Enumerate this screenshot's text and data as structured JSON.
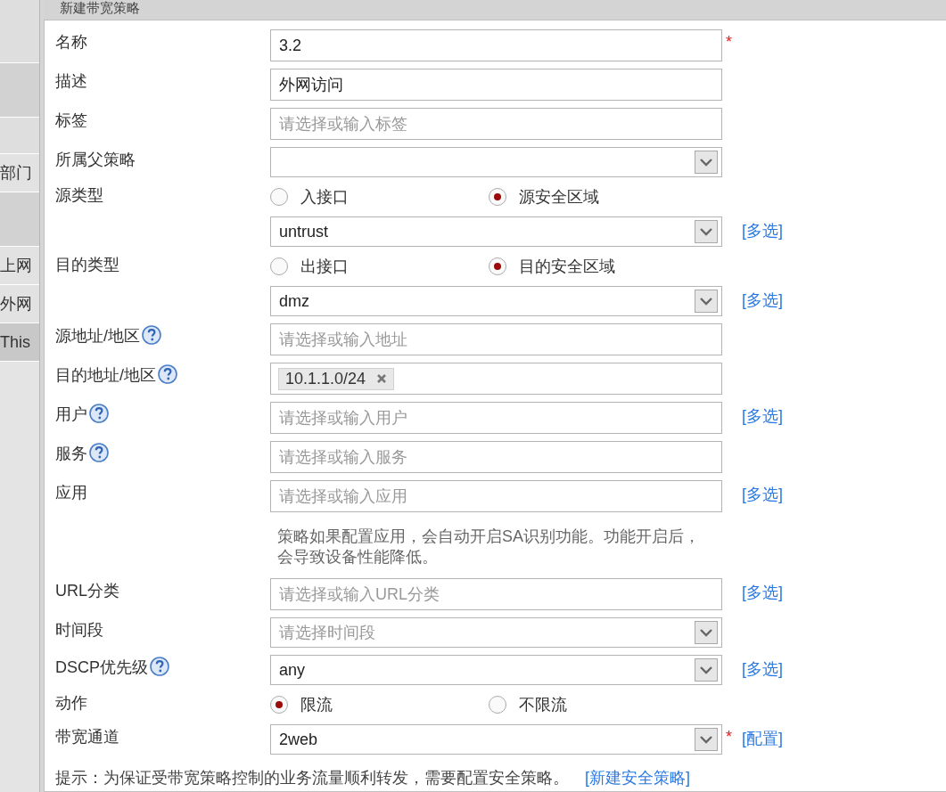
{
  "sidebar": {
    "items": [
      {
        "label": "部门",
        "selected": false
      },
      {
        "label": "上网",
        "selected": false
      },
      {
        "label": "外网",
        "selected": false
      },
      {
        "label": "This",
        "selected": true
      }
    ]
  },
  "dialog": {
    "title": "新建带宽策略"
  },
  "rows": [
    {
      "kind": "text",
      "label": "名称",
      "value": "3.2",
      "required_mark": "*"
    },
    {
      "kind": "text",
      "label": "描述",
      "value": "外网访问"
    },
    {
      "kind": "text",
      "label": "标签",
      "placeholder": "请选择或输入标签"
    },
    {
      "kind": "select",
      "label": "所属父策略"
    },
    {
      "kind": "radio",
      "label": "源类型",
      "options": [
        {
          "label": "入接口",
          "selected": false
        },
        {
          "label": "源安全区域",
          "selected": true
        }
      ]
    },
    {
      "kind": "select",
      "value": "untrust",
      "link": "[多选]"
    },
    {
      "kind": "radio",
      "label": "目的类型",
      "options": [
        {
          "label": "出接口",
          "selected": false
        },
        {
          "label": "目的安全区域",
          "selected": true
        }
      ]
    },
    {
      "kind": "select",
      "value": "dmz",
      "link": "[多选]"
    },
    {
      "kind": "text",
      "label": "源地址/地区",
      "help": true,
      "placeholder": "请选择或输入地址"
    },
    {
      "kind": "tags",
      "label": "目的地址/地区",
      "help": true,
      "tags": [
        "10.1.1.0/24"
      ]
    },
    {
      "kind": "text",
      "label": "用户",
      "help": true,
      "placeholder": "请选择或输入用户",
      "link": "[多选]"
    },
    {
      "kind": "text",
      "label": "服务",
      "help": true,
      "placeholder": "请选择或输入服务"
    },
    {
      "kind": "text",
      "label": "应用",
      "placeholder": "请选择或输入应用",
      "link": "[多选]"
    },
    {
      "kind": "note",
      "text": "策略如果配置应用，会自动开启SA识别功能。功能开启后，会导致设备性能降低。"
    },
    {
      "kind": "text",
      "label": "URL分类",
      "placeholder": "请选择或输入URL分类",
      "link": "[多选]"
    },
    {
      "kind": "select",
      "label": "时间段",
      "placeholder": "请选择时间段"
    },
    {
      "kind": "select",
      "label": "DSCP优先级",
      "help": true,
      "value": "any",
      "link": "[多选]"
    },
    {
      "kind": "radio",
      "label": "动作",
      "options": [
        {
          "label": "限流",
          "selected": true
        },
        {
          "label": "不限流",
          "selected": false
        }
      ]
    },
    {
      "kind": "select",
      "label": "带宽通道",
      "value": "2web",
      "required_mark": "*",
      "link": "[配置]"
    }
  ],
  "tip": {
    "text": "提示：为保证受带宽策略控制的业务流量顺利转发，需要配置安全策略。",
    "link": "[新建安全策略]"
  }
}
